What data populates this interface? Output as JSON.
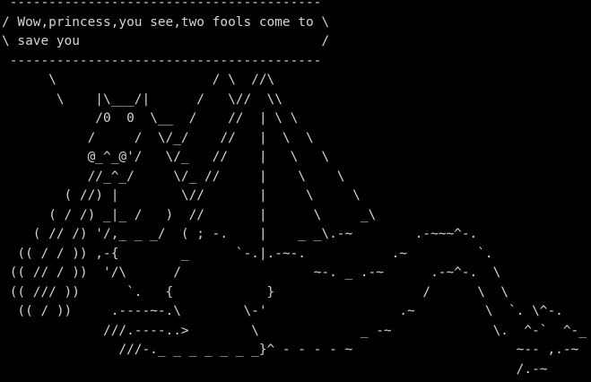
{
  "terminal": {
    "speech_bubble": [
      " ----------------------------------------",
      "/ Wow,princess,you see,two fools come to \\",
      "\\ save you                               /",
      " ----------------------------------------"
    ],
    "art": [
      "      \\                    / \\  //\\",
      "       \\    |\\___/|      /   \\//  \\\\",
      "            /0  0  \\__  /    //  | \\ \\",
      "           /     /  \\/_/    //   |  \\  \\",
      "           @_^_@'/   \\/_   //    |   \\   \\",
      "           //_^_/     \\/_ //     |    \\    \\",
      "        ( //) |        \\//       |     \\     \\",
      "      ( / /) _|_ /   )  //       |      \\     _\\",
      "    ( // /) '/,_ _ _/  ( ; -.    |    _ _\\.-~        .-~~~^-.",
      "  (( / / )) ,-{        _      `-.|.-~-.           .~         `.",
      " (( // / ))  '/\\      /                 ~-. _ .-~      .-~^-.  \\",
      " (( /// ))      `.   {            }                   /      \\  \\",
      "  (( / ))     .----~-.\\        \\-'                 .~         \\  `. \\^-.",
      "             ///.----..>        \\             _ -~             \\.  ^-`  ^-_",
      "               ///-._ _ _ _ _ _ _}^ - - - - ~                     ~-- ,.-~",
      "                                                                  /.-~"
    ]
  }
}
